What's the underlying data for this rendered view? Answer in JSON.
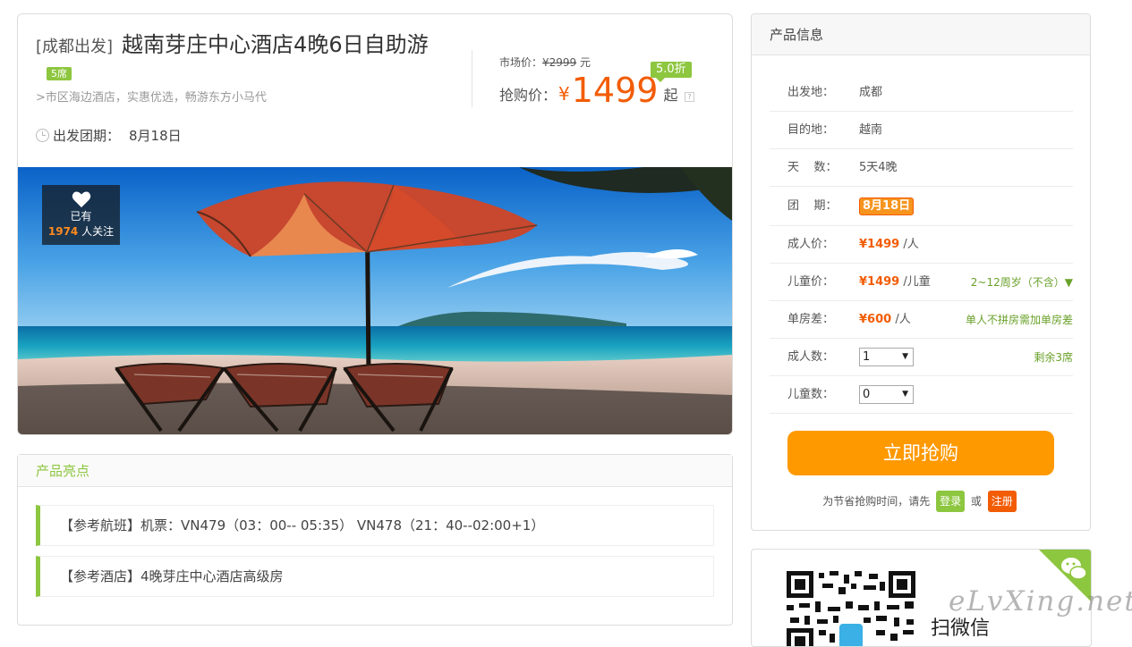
{
  "product": {
    "origin_prefix": "[成都出发]",
    "title": "越南芽庄中心酒店4晚6日自助游",
    "seats_badge": "5席",
    "subtitle": ">市区海边酒店，实惠优选，畅游东方小马代",
    "depart_label": "出发团期：",
    "depart_date": "8月18日"
  },
  "pricing": {
    "market_label": "市场价：",
    "market_currency": "¥",
    "market_price": "2999",
    "market_unit": "元",
    "discount": "5.0折",
    "buy_label": "抢购价：",
    "currency": "¥",
    "price": "1499",
    "price_suffix": "起",
    "help": "?"
  },
  "hero": {
    "fav_label": "已有",
    "fav_count": "1974",
    "fav_suffix": "人关注"
  },
  "highlights": {
    "title": "产品亮点",
    "items": [
      "【参考航班】机票：VN479（03：00-- 05:35） VN478（21：40--02:00+1）",
      "【参考酒店】4晚芽庄中心酒店高级房"
    ]
  },
  "info": {
    "title": "产品信息",
    "rows": [
      {
        "label": "出发地：",
        "value": "成都"
      },
      {
        "label": "目的地：",
        "value": "越南"
      },
      {
        "label": "天    数：",
        "value": "5天4晚"
      },
      {
        "label": "团    期：",
        "value": "8月18日"
      },
      {
        "label": "成人价：",
        "price": "¥1499",
        "unit": "/人"
      },
      {
        "label": "儿童价：",
        "price": "¥1499",
        "unit": "/儿童",
        "note": "2~12周岁（不含）▼"
      },
      {
        "label": "单房差：",
        "price": "¥600",
        "unit": "/人",
        "note": "单人不拼房需加单房差"
      },
      {
        "label": "成人数：",
        "select": "1",
        "note": "剩余3席"
      },
      {
        "label": "儿童数：",
        "select": "0"
      }
    ],
    "buy_button": "立即抢购",
    "login_prompt": "为节省抢购时间，请先",
    "login_button": "登录",
    "or": "或",
    "register_button": "注册"
  },
  "qr": {
    "scan_text": "扫微信"
  },
  "watermark": "eLvXing.net",
  "colors": {
    "accent_green": "#8dc63f",
    "price_orange": "#f25c05",
    "button_orange": "#ff9900"
  }
}
